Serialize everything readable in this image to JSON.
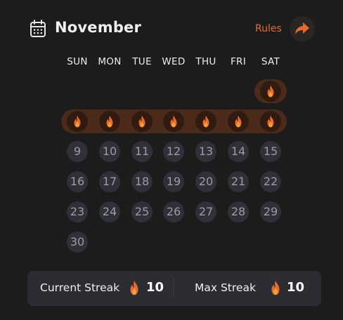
{
  "header": {
    "month": "November",
    "rules_label": "Rules",
    "calendar_icon": "calendar-icon",
    "share_icon": "share-arrow-icon"
  },
  "weekdays": [
    "SUN",
    "MON",
    "TUE",
    "WED",
    "THU",
    "FRI",
    "SAT"
  ],
  "calendar": {
    "first_weekday_index": 6,
    "days_in_month": 30,
    "streak_days": [
      1,
      2,
      3,
      4,
      5,
      6,
      7,
      8
    ],
    "streak_icon": "flame-icon"
  },
  "stats": {
    "current_streak_label": "Current Streak",
    "current_streak_value": "10",
    "max_streak_label": "Max Streak",
    "max_streak_value": "10"
  },
  "colors": {
    "background": "#1c1c1c",
    "accent": "#ea6a2e",
    "streak_band": "#4b2a1a",
    "day_bg": "#2f3038",
    "day_text": "#9c9ca4",
    "stats_bg": "#2c2d33"
  }
}
